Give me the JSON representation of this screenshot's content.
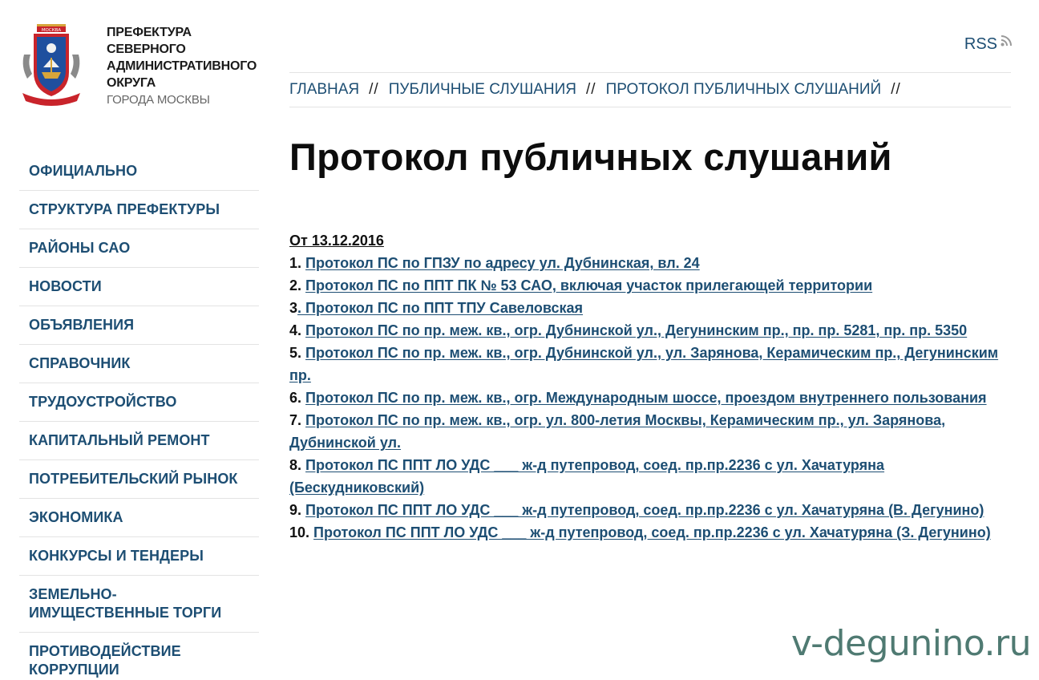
{
  "header": {
    "org_lines": [
      "ПРЕФЕКТУРА",
      "СЕВЕРНОГО",
      "АДМИНИСТРАТИВНОГО",
      "ОКРУГА"
    ],
    "city_line": "ГОРОДА МОСКВЫ",
    "logo_text": "МОСКВА",
    "rss_label": "RSS"
  },
  "breadcrumb": {
    "items": [
      "ГЛАВНАЯ",
      "ПУБЛИЧНЫЕ СЛУШАНИЯ",
      "ПРОТОКОЛ ПУБЛИЧНЫХ СЛУШАНИЙ"
    ],
    "separator": "//"
  },
  "page_title": "Протокол публичных слушаний",
  "sidebar": {
    "items": [
      "ОФИЦИАЛЬНО",
      "СТРУКТУРА ПРЕФЕКТУРЫ",
      "РАЙОНЫ САО",
      "НОВОСТИ",
      "ОБЪЯВЛЕНИЯ",
      "СПРАВОЧНИК",
      "ТРУДОУСТРОЙСТВО",
      "КАПИТАЛЬНЫЙ РЕМОНТ",
      "ПОТРЕБИТЕЛЬСКИЙ РЫНОК",
      "ЭКОНОМИКА",
      "КОНКУРСЫ И ТЕНДЕРЫ",
      "ЗЕМЕЛЬНО-ИМУЩЕСТВЕННЫЕ ТОРГИ",
      "ПРОТИВОДЕЙСТВИЕ КОРРУПЦИИ"
    ]
  },
  "content": {
    "date_heading": "От 13.12.2016",
    "entries": [
      {
        "num": "1.",
        "text": "Протокол ПС по ГПЗУ по адресу ул. Дубнинская, вл. 24"
      },
      {
        "num": "2.",
        "text": "Протокол ПС по ППТ ПК № 53 САО, включая участок прилегающей территории"
      },
      {
        "num": "3",
        "text": ". Протокол ПС по ППТ ТПУ Савеловская"
      },
      {
        "num": "4.",
        "text": "Протокол ПС по пр. меж. кв., огр. Дубнинской ул., Дегунинским пр., пр. пр. 5281, пр. пр. 5350"
      },
      {
        "num": "5.",
        "text": "Протокол ПС по пр. меж. кв., огр. Дубнинской ул., ул. Зарянова, Керамическим пр., Дегунинским пр."
      },
      {
        "num": "6.",
        "text": "Протокол ПС по пр. меж. кв., огр. Международным шоссе, проездом внутреннего пользования"
      },
      {
        "num": "7.",
        "text": "Протокол ПС по пр. меж. кв., огр. ул. 800-летия Москвы, Керамическим пр., ул. Зарянова, Дубнинской ул."
      },
      {
        "num": "8.",
        "text": "Протокол ПС ППТ ЛО УДС ___ ж-д путепровод, соед. пр.пр.2236 с ул. Хачатуряна (Бескудниковский)"
      },
      {
        "num": "9.",
        "text": "Протокол ПС ППТ ЛО УДС ___ ж-д путепровод, соед. пр.пр.2236 с ул. Хачатуряна (В. Дегунино)"
      },
      {
        "num": "10.",
        "text": "Протокол ПС ППТ ЛО УДС ___ ж-д путепровод, соед. пр.пр.2236 с ул. Хачатуряна (З. Дегунино)"
      }
    ]
  },
  "watermark": "v-degunino.ru",
  "colors": {
    "link": "#1d4e73",
    "divider": "#e3e3e3",
    "watermark": "#4f7a72"
  }
}
